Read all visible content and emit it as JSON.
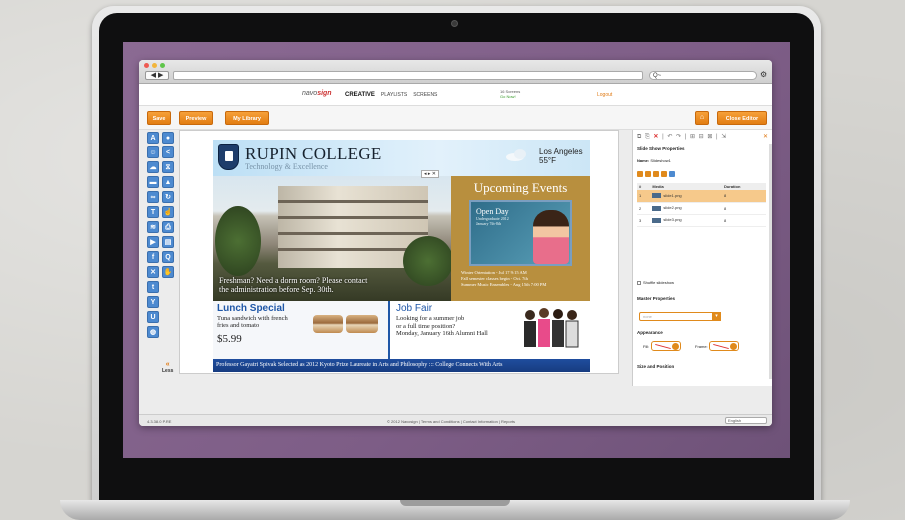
{
  "browser": {
    "search_placeholder": "Q~",
    "nav": "◀ ▶"
  },
  "app": {
    "logo_prefix": "navo",
    "logo_suffix": "sign",
    "tabs": [
      "CREATIVE",
      "PLAYLISTS",
      "SCREENS"
    ],
    "screens_count": "16 Screens",
    "screens_status": "Go Now!",
    "logout": "Logout"
  },
  "toolbar": {
    "save": "Save",
    "preview": "Preview",
    "library": "My Library",
    "close": "Close Editor"
  },
  "palette": {
    "less": "Less",
    "less_arrow": "«"
  },
  "slide": {
    "college": "RUPIN COLLEGE",
    "tagline": "Technology & Excellence",
    "city": "Los Angeles",
    "temp": "55°F",
    "photo_caption_1": "Freshman? Need a dorm room? Please contact",
    "photo_caption_2": "the administration before Sep. 30th.",
    "events_title": "Upcoming Events",
    "event_name": "Open Day",
    "event_sub": "Undergraduate 2012",
    "event_date": "January 7th-8th",
    "event_line_1": "Winter Orientation - Jul 17 9:15 AM",
    "event_line_2": "Fall semester classes begin - Oct. 7th",
    "event_line_3": "Summer Music Ensembles - Aug 15th 7:00 PM",
    "lunch_title": "Lunch Special",
    "lunch_desc_1": "Tuna sandwich with french",
    "lunch_desc_2": "fries and tomato",
    "lunch_price": "$5.99",
    "job_title": "Job Fair",
    "job_desc_1": "Looking for a summer job",
    "job_desc_2": "or a full time position?",
    "job_desc_3": "Monday, January 16th  Alumni Hall",
    "ticker": "Professor Gayatri Spivak Selected as 2012 Kyoto Prize Laureate in Arts and Philosophy ::: College Connects With Arts"
  },
  "props": {
    "title": "Slide Show Properties",
    "name_label": "Name:",
    "name_value": "Slideshow1",
    "columns": [
      "#",
      "Media",
      "Duration"
    ],
    "rows": [
      {
        "n": "1",
        "media": "slide1.png",
        "dur": "8"
      },
      {
        "n": "2",
        "media": "slide2.png",
        "dur": "8"
      },
      {
        "n": "3",
        "media": "slide3.png",
        "dur": "8"
      }
    ],
    "shuffle": "Shuffle slideshow",
    "master": "Master Properties",
    "master_value": "none",
    "appearance": "Appearance",
    "fill": "Fill:",
    "frame": "Frame:",
    "size_pos": "Size and Position"
  },
  "status": {
    "version": "4.3.38.0 P.RE",
    "copyright": "© 2012 Navosign | Terms and Conditions | Contact Information | Reports",
    "language": "English"
  },
  "colors": {
    "accent": "#e27d12",
    "brand_blue": "#1f57a7",
    "screen_purple": "#7d5d86"
  }
}
